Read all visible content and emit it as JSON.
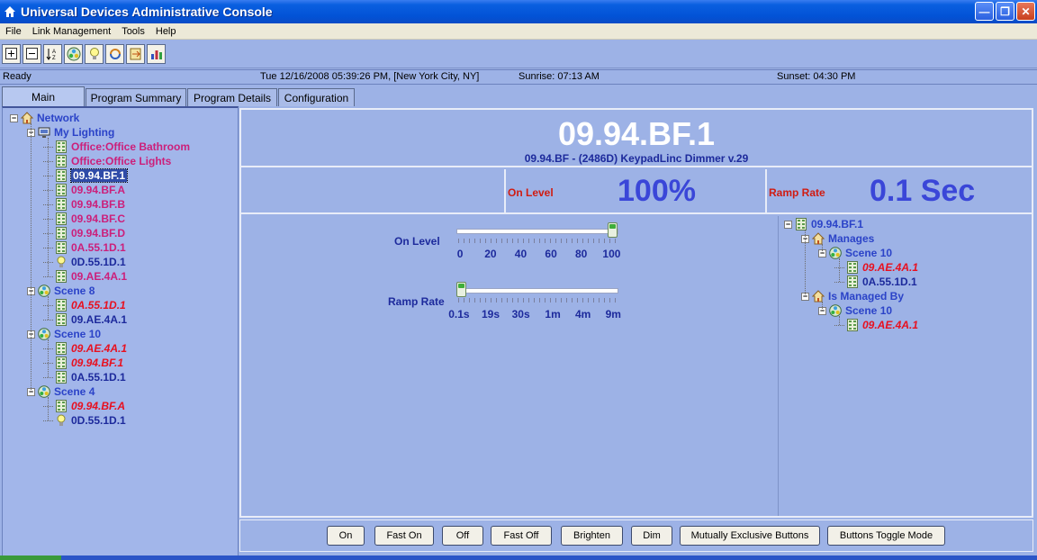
{
  "window": {
    "title": "Universal Devices Administrative Console"
  },
  "menu": [
    "File",
    "Link Management",
    "Tools",
    "Help"
  ],
  "toolbar": {
    "buttons": [
      "expand-all-icon",
      "collapse-all-icon",
      "sort-icon",
      "scene-icon",
      "bulb-icon",
      "link-icon",
      "export-icon",
      "chart-icon"
    ]
  },
  "status": {
    "state": "Ready",
    "datetime": "Tue 12/16/2008 05:39:26 PM,  [New York City, NY]",
    "sunrise": "Sunrise: 07:13 AM",
    "sunset": "Sunset: 04:30 PM"
  },
  "tabs": [
    "Main",
    "Program Summary",
    "Program Details",
    "Configuration"
  ],
  "tree": [
    {
      "label": "Network",
      "level": 0,
      "icon": "house",
      "color": "blue",
      "exp": "-"
    },
    {
      "label": "My Lighting",
      "level": 1,
      "icon": "monitor",
      "color": "blue",
      "exp": "-"
    },
    {
      "label": "Office:Office Bathroom",
      "level": 2,
      "icon": "keypad",
      "color": "magenta"
    },
    {
      "label": "Office:Office Lights",
      "level": 2,
      "icon": "keypad",
      "color": "magenta"
    },
    {
      "label": "09.94.BF.1",
      "level": 2,
      "icon": "keypad",
      "color": "selected"
    },
    {
      "label": "09.94.BF.A",
      "level": 2,
      "icon": "keypad",
      "color": "magenta"
    },
    {
      "label": "09.94.BF.B",
      "level": 2,
      "icon": "keypad",
      "color": "magenta"
    },
    {
      "label": "09.94.BF.C",
      "level": 2,
      "icon": "keypad",
      "color": "magenta"
    },
    {
      "label": "09.94.BF.D",
      "level": 2,
      "icon": "keypad",
      "color": "magenta"
    },
    {
      "label": "0A.55.1D.1",
      "level": 2,
      "icon": "keypad",
      "color": "magenta"
    },
    {
      "label": "0D.55.1D.1",
      "level": 2,
      "icon": "bulb",
      "color": "navy"
    },
    {
      "label": "09.AE.4A.1",
      "level": 2,
      "icon": "keypad",
      "color": "magenta"
    },
    {
      "label": "Scene 8",
      "level": 1,
      "icon": "scene",
      "color": "blue",
      "exp": "-"
    },
    {
      "label": "0A.55.1D.1",
      "level": 2,
      "icon": "keypad",
      "color": "red"
    },
    {
      "label": "09.AE.4A.1",
      "level": 2,
      "icon": "keypad",
      "color": "navy"
    },
    {
      "label": "Scene 10",
      "level": 1,
      "icon": "scene",
      "color": "blue",
      "exp": "-"
    },
    {
      "label": "09.AE.4A.1",
      "level": 2,
      "icon": "keypad",
      "color": "red"
    },
    {
      "label": "09.94.BF.1",
      "level": 2,
      "icon": "keypad",
      "color": "red"
    },
    {
      "label": "0A.55.1D.1",
      "level": 2,
      "icon": "keypad",
      "color": "navy"
    },
    {
      "label": "Scene 4",
      "level": 1,
      "icon": "scene",
      "color": "blue",
      "exp": "-"
    },
    {
      "label": "09.94.BF.A",
      "level": 2,
      "icon": "keypad",
      "color": "red"
    },
    {
      "label": "0D.55.1D.1",
      "level": 2,
      "icon": "bulb",
      "color": "navy"
    }
  ],
  "device": {
    "name": "09.94.BF.1",
    "description": "09.94.BF  -  (2486D) KeypadLinc Dimmer v.29",
    "on_level_label": "On Level",
    "on_level_value": "100%",
    "ramp_rate_label": "Ramp Rate",
    "ramp_rate_value": "0.1 Sec"
  },
  "sliders": {
    "on_level": {
      "label": "On Level",
      "scale": [
        "0",
        "20",
        "40",
        "60",
        "80",
        "100"
      ],
      "value_fraction": 1.0
    },
    "ramp_rate": {
      "label": "Ramp Rate",
      "scale": [
        "0.1s",
        "19s",
        "30s",
        "1m",
        "4m",
        "9m"
      ],
      "value_fraction": 0.0
    }
  },
  "links": [
    {
      "label": "09.94.BF.1",
      "level": 0,
      "icon": "keypad",
      "color": "blue",
      "exp": "-"
    },
    {
      "label": "Manages",
      "level": 1,
      "icon": "house",
      "color": "blue",
      "exp": "-"
    },
    {
      "label": "Scene 10",
      "level": 2,
      "icon": "scene",
      "color": "blue",
      "exp": "-"
    },
    {
      "label": "09.AE.4A.1",
      "level": 3,
      "icon": "keypad",
      "color": "red"
    },
    {
      "label": "0A.55.1D.1",
      "level": 3,
      "icon": "keypad",
      "color": "navy"
    },
    {
      "label": "Is Managed By",
      "level": 1,
      "icon": "house",
      "color": "blue",
      "exp": "-"
    },
    {
      "label": "Scene 10",
      "level": 2,
      "icon": "scene",
      "color": "blue",
      "exp": "-"
    },
    {
      "label": "09.AE.4A.1",
      "level": 3,
      "icon": "keypad",
      "color": "red"
    }
  ],
  "buttons": [
    "On",
    "Fast On",
    "Off",
    "Fast Off",
    "Brighten",
    "Dim",
    "Mutually Exclusive Buttons",
    "Buttons Toggle Mode"
  ]
}
